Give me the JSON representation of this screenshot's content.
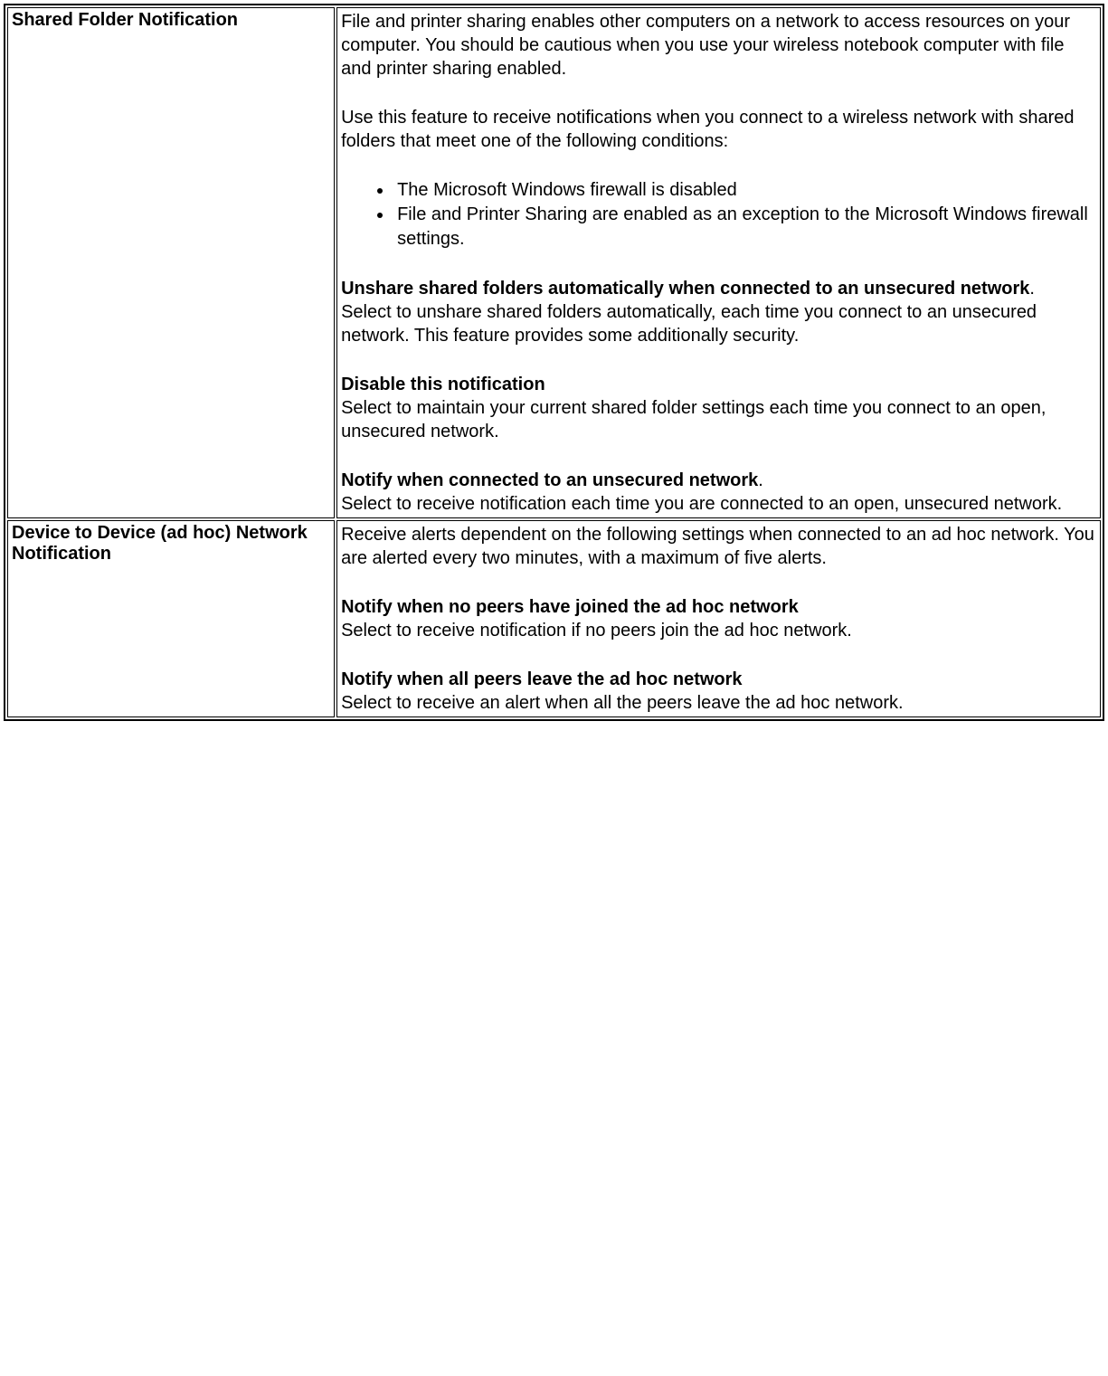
{
  "rows": [
    {
      "label": "Shared Folder Notification",
      "p1": "File and printer sharing enables other computers on a network to access resources on your computer. You should be cautious when you use your wireless notebook computer with file and printer sharing enabled.",
      "p2": "Use this feature to receive notifications when you connect to a wireless network with shared folders that meet one of the following conditions:",
      "li1": "The Microsoft Windows firewall is disabled",
      "li2": "File and Printer Sharing are enabled as an exception to the Microsoft Windows firewall settings.",
      "h3a": "Unshare shared folders automatically when connected to an unsecured network",
      "h3a_dot": ".",
      "p3a": "Select to unshare shared folders automatically, each time you connect to an unsecured network. This feature provides some additionally security.",
      "h3b": "Disable this notification",
      "p3b": "Select to maintain your current shared folder settings each time you connect to an open, unsecured network.",
      "h3c": "Notify when connected to an unsecured network",
      "h3c_dot": ".",
      "p3c": "Select to receive notification each time you are connected to an open, unsecured network."
    },
    {
      "label": "Device to Device (ad hoc) Network Notification",
      "p1": "Receive alerts dependent on the following settings when connected to an ad hoc network. You are alerted every two minutes, with a maximum of five alerts.",
      "h3a": "Notify when no peers have joined the ad hoc network",
      "p3a": "Select to receive notification if no peers join the ad hoc network.",
      "h3b": "Notify when all peers leave the ad hoc network",
      "p3b": "Select to receive an alert when all the peers leave the ad hoc network."
    }
  ]
}
